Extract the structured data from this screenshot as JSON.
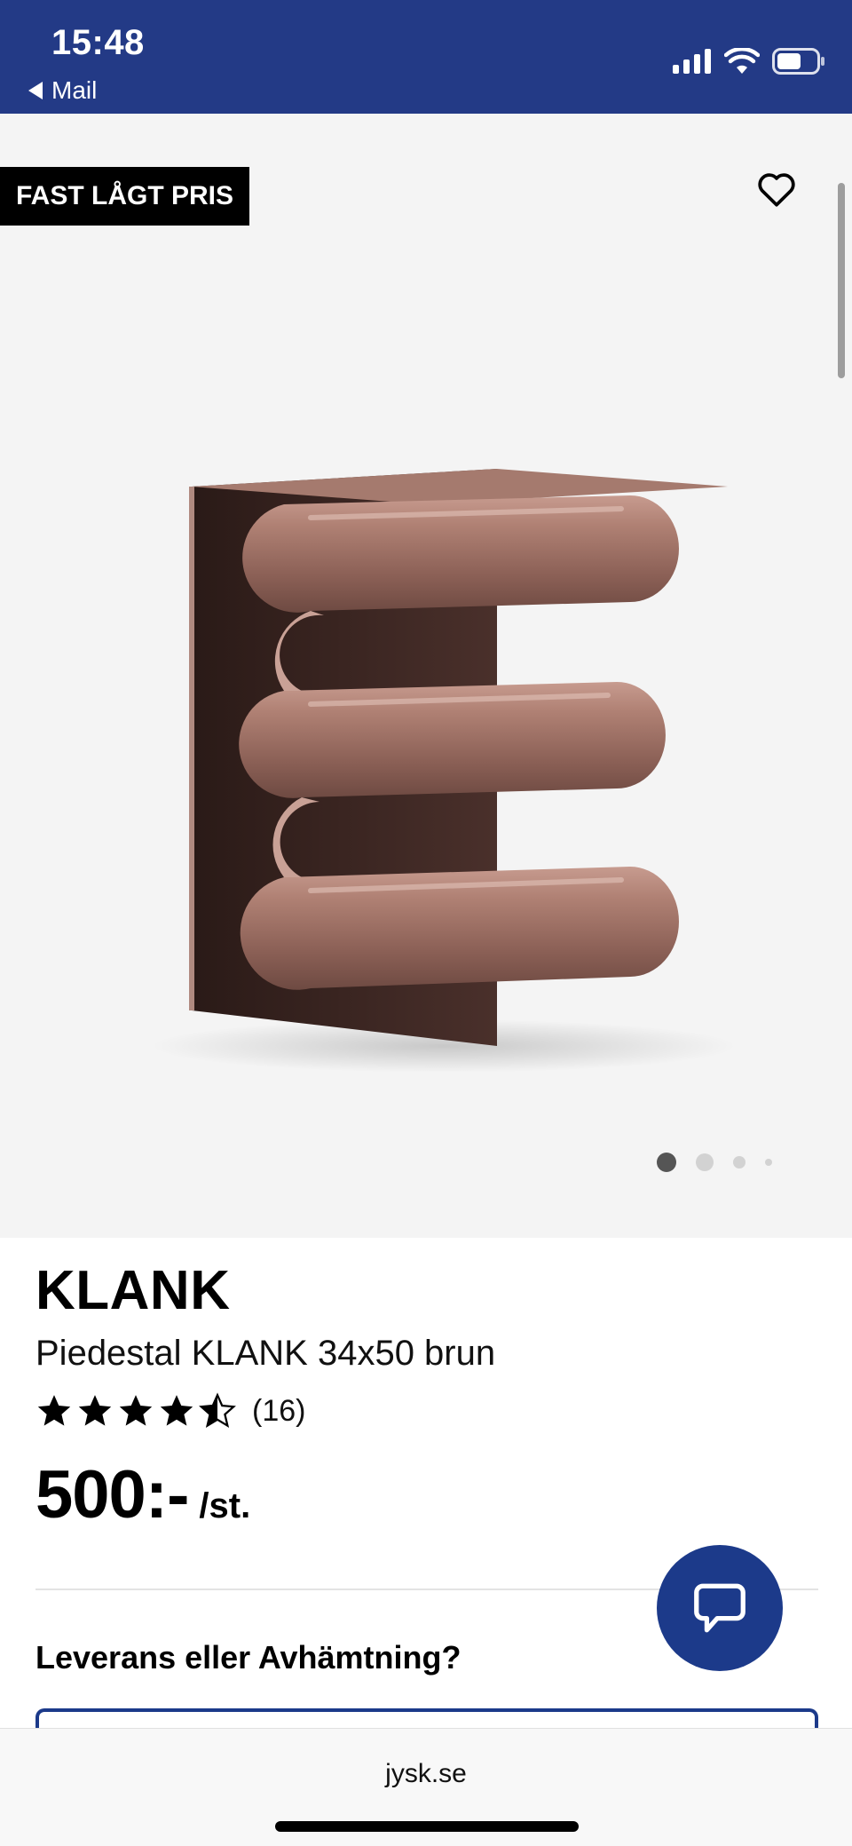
{
  "status_bar": {
    "time": "15:48",
    "back_label": "Mail",
    "background": "#233a86"
  },
  "gallery": {
    "badge": "FAST LÅGT PRIS",
    "wishlist_icon": "heart-outline-icon",
    "image_count": 4,
    "active_image": 1
  },
  "product": {
    "brand": "KLANK",
    "name": "Piedestal KLANK 34x50 brun",
    "rating": 4.5,
    "rating_max": 5,
    "review_count": "(16)",
    "price": "500:-",
    "unit": "/st."
  },
  "delivery": {
    "heading": "Leverans eller Avhämtning?"
  },
  "chat": {
    "icon": "chat-bubble-icon",
    "color": "#1c3a8a"
  },
  "browser": {
    "url": "jysk.se"
  }
}
